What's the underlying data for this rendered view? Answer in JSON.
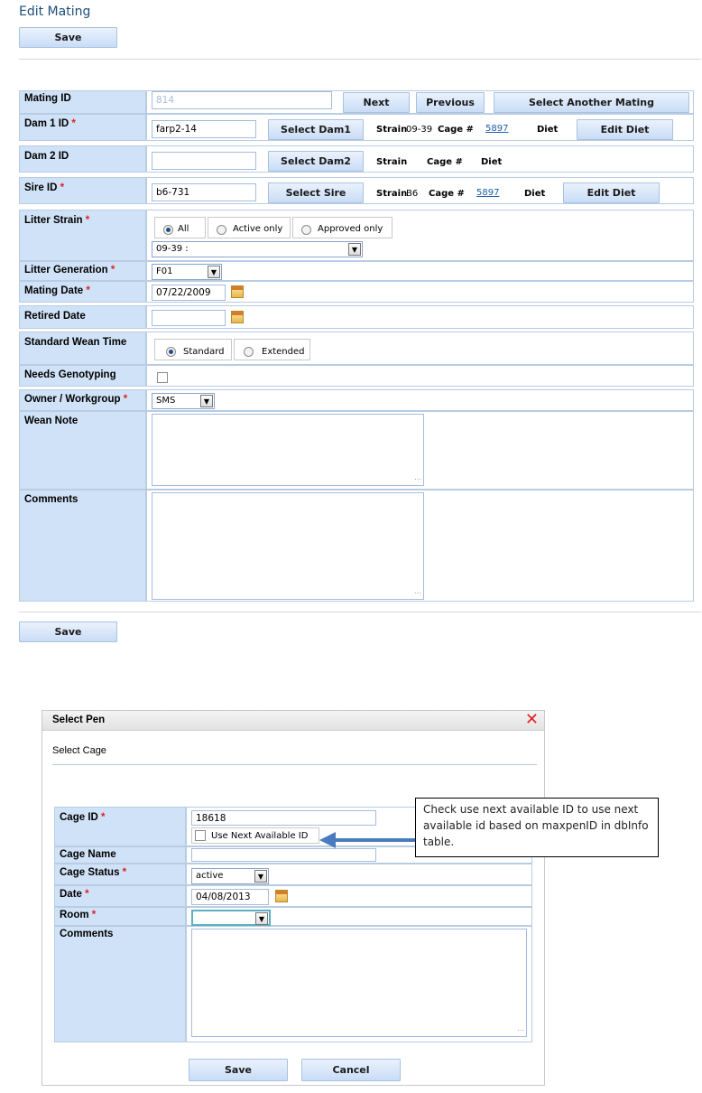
{
  "page": {
    "title": "Edit Mating",
    "save_label": "Save"
  },
  "form": {
    "mating_id": {
      "label": "Mating ID",
      "value": "814",
      "next": "Next",
      "previous": "Previous",
      "select_another": "Select Another Mating"
    },
    "dam1": {
      "label": "Dam 1 ID",
      "value": "farp2-14",
      "button": "Select Dam1",
      "strain_label": "Strain",
      "strain": "09-39",
      "cage_label": "Cage #",
      "cage": "5897",
      "diet_label": "Diet",
      "edit_diet": "Edit Diet"
    },
    "dam2": {
      "label": "Dam 2 ID",
      "value": "",
      "button": "Select Dam2",
      "strain_label": "Strain",
      "cage_label": "Cage #",
      "diet_label": "Diet"
    },
    "sire": {
      "label": "Sire ID",
      "value": "b6-731",
      "button": "Select Sire",
      "strain_label": "Strain",
      "strain": "B6",
      "cage_label": "Cage #",
      "cage": "5897",
      "diet_label": "Diet",
      "edit_diet": "Edit Diet"
    },
    "litter_strain": {
      "label": "Litter Strain",
      "options": [
        "All",
        "Active only",
        "Approved only"
      ],
      "selected": "All",
      "select_value": "09-39 :"
    },
    "litter_generation": {
      "label": "Litter Generation",
      "value": "F01"
    },
    "mating_date": {
      "label": "Mating Date",
      "value": "07/22/2009"
    },
    "retired_date": {
      "label": "Retired Date",
      "value": ""
    },
    "wean_time": {
      "label": "Standard Wean Time",
      "options": [
        "Standard",
        "Extended"
      ],
      "selected": "Standard"
    },
    "needs_genotyping": {
      "label": "Needs Genotyping"
    },
    "owner": {
      "label": "Owner / Workgroup",
      "value": "SMS"
    },
    "wean_note": {
      "label": "Wean Note"
    },
    "comments": {
      "label": "Comments"
    },
    "required_mark": "*"
  },
  "dialog": {
    "title": "Select Pen",
    "subtitle": "Select Cage",
    "cage_id": {
      "label": "Cage ID",
      "value": "18618",
      "checkbox_label": "Use Next Available ID"
    },
    "cage_name": {
      "label": "Cage Name",
      "value": ""
    },
    "cage_status": {
      "label": "Cage Status",
      "value": "active"
    },
    "date": {
      "label": "Date",
      "value": "04/08/2013"
    },
    "room": {
      "label": "Room",
      "value": ""
    },
    "comments": {
      "label": "Comments"
    },
    "save": "Save",
    "cancel": "Cancel",
    "close_icon": "close-icon"
  },
  "callout": {
    "text": "Check use next available ID to use next available id based on maxpenID in dbInfo table."
  },
  "colors": {
    "label_bg": "#d0e2f7",
    "title_blue": "#1f4e7a",
    "required_red": "#e02020",
    "arrow_blue": "#4a7bbf"
  }
}
